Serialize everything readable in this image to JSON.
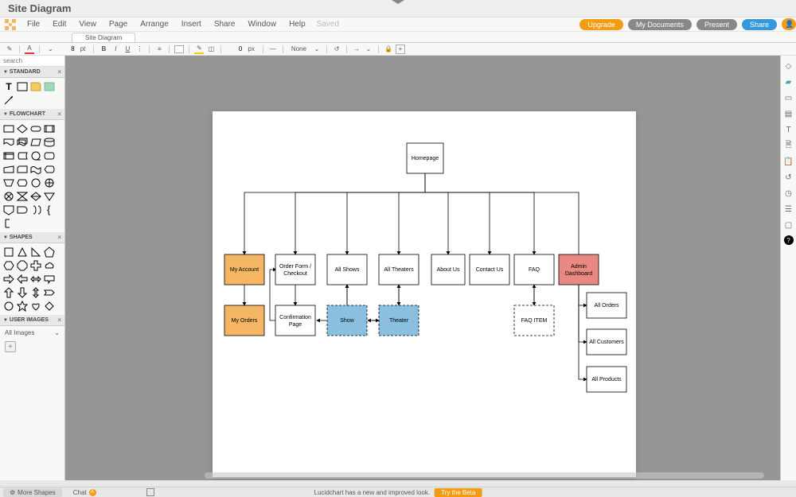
{
  "title": "Site Diagram",
  "menu": {
    "items": [
      "File",
      "Edit",
      "View",
      "Page",
      "Arrange",
      "Insert",
      "Share",
      "Window",
      "Help"
    ],
    "saved": "Saved"
  },
  "header_buttons": {
    "upgrade": "Upgrade",
    "docs": "My Documents",
    "present": "Present",
    "share": "Share"
  },
  "tab": {
    "name": "Site Diagram"
  },
  "toolbar": {
    "font_size": "8",
    "font_unit": "pt",
    "border_w": "0",
    "border_unit": "px",
    "line_style": "None"
  },
  "leftpanel": {
    "search_placeholder": "search",
    "sections": {
      "standard": "STANDARD",
      "flowchart": "FLOWCHART",
      "shapes": "SHAPES",
      "user_images": "USER IMAGES"
    },
    "all_images": "All Images"
  },
  "bottom": {
    "more_shapes": "More Shapes",
    "chat": "Chat",
    "chat_badge": "A",
    "banner": "Lucidchart has a new and improved look.",
    "try_beta": "Try the Beta"
  },
  "chart_data": {
    "type": "tree",
    "nodes": [
      {
        "id": "home",
        "label": "Homepage",
        "row": 0,
        "fill": "#ffffff"
      },
      {
        "id": "acct",
        "label": "My Account",
        "row": 1,
        "fill": "#f4b565"
      },
      {
        "id": "order",
        "label": "Order Form / Checkout",
        "row": 1,
        "fill": "#ffffff"
      },
      {
        "id": "shows",
        "label": "All Shows",
        "row": 1,
        "fill": "#ffffff"
      },
      {
        "id": "theaters",
        "label": "All Theaters",
        "row": 1,
        "fill": "#ffffff"
      },
      {
        "id": "about",
        "label": "About Us",
        "row": 1,
        "fill": "#ffffff"
      },
      {
        "id": "contact",
        "label": "Contact Us",
        "row": 1,
        "fill": "#ffffff"
      },
      {
        "id": "faq",
        "label": "FAQ",
        "row": 1,
        "fill": "#ffffff"
      },
      {
        "id": "admin",
        "label": "Admin Dashboard",
        "row": 1,
        "fill": "#e88a82"
      },
      {
        "id": "myorders",
        "label": "My Orders",
        "row": 2,
        "fill": "#f4b565"
      },
      {
        "id": "confirm",
        "label": "Confirmation Page",
        "row": 2,
        "fill": "#ffffff"
      },
      {
        "id": "show",
        "label": "Show",
        "row": 2,
        "fill": "#8bbfe0",
        "dashed": true
      },
      {
        "id": "theater",
        "label": "Theater",
        "row": 2,
        "fill": "#8bbfe0",
        "dashed": true
      },
      {
        "id": "faqitem",
        "label": "FAQ ITEM",
        "row": 2,
        "fill": "#ffffff",
        "dashed": true
      },
      {
        "id": "allorders",
        "label": "All Orders",
        "row": 2,
        "fill": "#ffffff"
      },
      {
        "id": "allcust",
        "label": "All Customers",
        "row": 2,
        "fill": "#ffffff"
      },
      {
        "id": "allprod",
        "label": "All Products",
        "row": 2,
        "fill": "#ffffff"
      }
    ],
    "edges": [
      [
        "home",
        "acct"
      ],
      [
        "home",
        "order"
      ],
      [
        "home",
        "shows"
      ],
      [
        "home",
        "theaters"
      ],
      [
        "home",
        "about"
      ],
      [
        "home",
        "contact"
      ],
      [
        "home",
        "faq"
      ],
      [
        "home",
        "admin"
      ],
      [
        "acct",
        "myorders"
      ],
      [
        "order",
        "confirm"
      ],
      [
        "shows",
        "show"
      ],
      [
        "theaters",
        "theater"
      ],
      [
        "faq",
        "faqitem"
      ],
      [
        "admin",
        "allorders"
      ],
      [
        "admin",
        "allcust"
      ],
      [
        "admin",
        "allprod"
      ],
      [
        "show",
        "theater",
        "bidir"
      ],
      [
        "confirm",
        "show",
        "to_confirm"
      ]
    ]
  }
}
